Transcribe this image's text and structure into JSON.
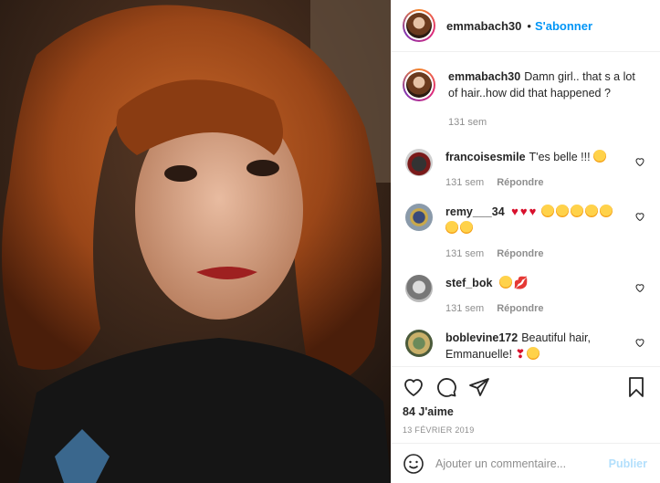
{
  "header": {
    "username": "emmabach30",
    "separator": "•",
    "follow_label": "S'abonner"
  },
  "caption": {
    "username": "emmabach30",
    "text": "Damn girl.. that s a lot of hair..how did that happened ?",
    "time": "131 sem"
  },
  "comments": [
    {
      "username": "francoisesmile",
      "text": "T'es belle !!!",
      "time": "131 sem",
      "reply_label": "Répondre"
    },
    {
      "username": "remy___34",
      "text": "",
      "time": "131 sem",
      "reply_label": "Répondre"
    },
    {
      "username": "stef_bok",
      "text": "",
      "time": "131 sem",
      "reply_label": "Répondre"
    },
    {
      "username": "boblevine172",
      "text": "Beautiful hair, Emmanuelle!",
      "time": "",
      "reply_label": ""
    }
  ],
  "actions": {
    "likes": "84 J'aime",
    "date": "13 FÉVRIER 2019"
  },
  "add_comment": {
    "placeholder": "Ajouter un commentaire...",
    "publish_label": "Publier"
  },
  "colors": {
    "accent": "#0095f6",
    "publish_disabled": "#b2dffc",
    "muted": "#8e8e8e",
    "border": "#efefef"
  }
}
